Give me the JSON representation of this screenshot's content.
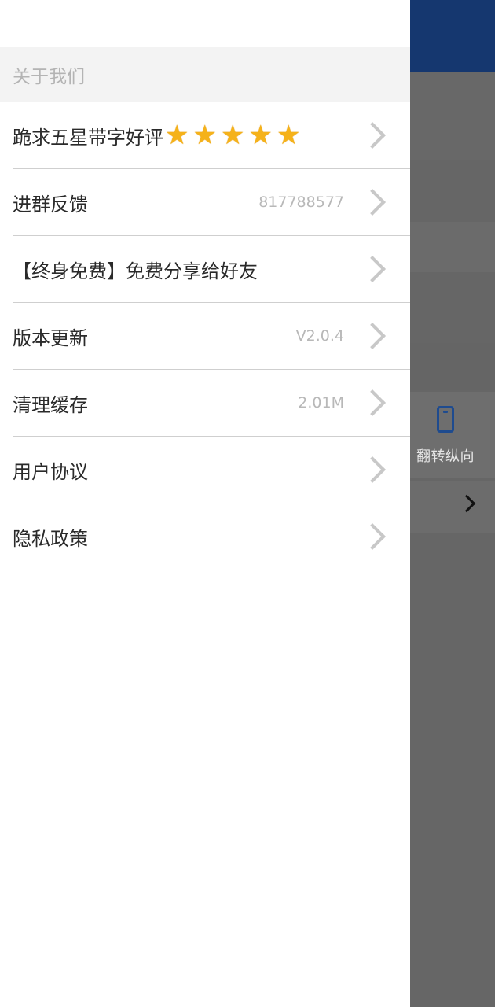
{
  "background": {
    "flip_label": "翻转纵向"
  },
  "drawer": {
    "section_header": "关于我们",
    "items": [
      {
        "label": "跪求五星带字好评",
        "value": "",
        "stars": 5
      },
      {
        "label": "进群反馈",
        "value": "817788577"
      },
      {
        "label": "【终身免费】免费分享给好友",
        "value": ""
      },
      {
        "label": "版本更新",
        "value": "V2.0.4"
      },
      {
        "label": "清理缓存",
        "value": "2.01M"
      },
      {
        "label": "用户协议",
        "value": ""
      },
      {
        "label": "隐私政策",
        "value": ""
      }
    ]
  },
  "icons": {
    "star": "star-icon",
    "chevron": "chevron-right-icon",
    "phone": "phone-portrait-icon"
  },
  "colors": {
    "accent": "#15376f",
    "star": "#f5b21a",
    "overlay": "#666666"
  }
}
